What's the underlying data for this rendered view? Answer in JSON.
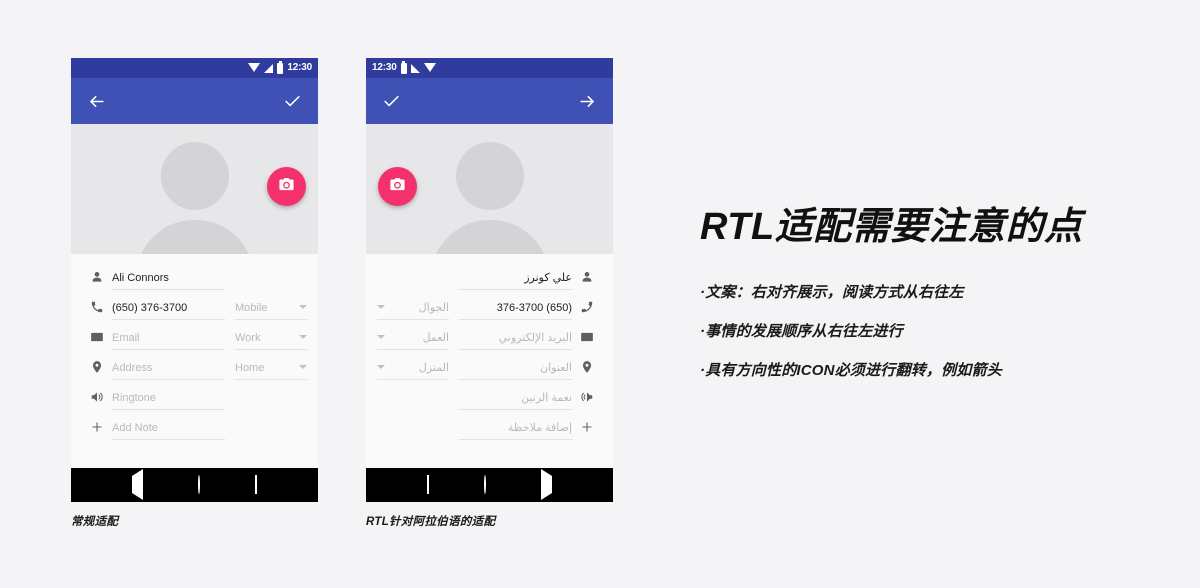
{
  "page": {
    "background": "#f4f4f6",
    "accent_appbar": "#3f51b5",
    "accent_statusbar": "#2f3c9e",
    "accent_fab": "#f5316d"
  },
  "phone_ltr": {
    "caption": "常规适配",
    "status_bar": {
      "time": "12:30",
      "icons": [
        "wifi-icon",
        "signal-icon",
        "battery-icon"
      ]
    },
    "app_bar": {
      "nav_icon": "arrow-back-icon",
      "action_icon": "check-icon"
    },
    "header": {
      "avatar": "person-placeholder-avatar",
      "fab_icon": "camera-icon"
    },
    "fields": [
      {
        "icon": "person-icon",
        "value": "Ali Connors",
        "is_placeholder": false,
        "type": ""
      },
      {
        "icon": "phone-icon",
        "value": "(650) 376-3700",
        "is_placeholder": false,
        "type": "Mobile"
      },
      {
        "icon": "email-icon",
        "value": "Email",
        "is_placeholder": true,
        "type": "Work"
      },
      {
        "icon": "location-icon",
        "value": "Address",
        "is_placeholder": true,
        "type": "Home"
      },
      {
        "icon": "ringtone-icon",
        "value": "Ringtone",
        "is_placeholder": true,
        "type": ""
      },
      {
        "icon": "plus-icon",
        "value": "Add Note",
        "is_placeholder": true,
        "type": ""
      }
    ],
    "nav_bar": [
      "back-triangle-icon",
      "home-circle-icon",
      "recents-square-icon"
    ]
  },
  "phone_rtl": {
    "caption": "RTL针对阿拉伯语的适配",
    "status_bar": {
      "time": "12:30",
      "icons": [
        "battery-icon",
        "signal-icon-mirrored",
        "wifi-icon"
      ]
    },
    "app_bar": {
      "nav_icon": "check-icon",
      "action_icon": "arrow-forward-icon"
    },
    "header": {
      "avatar": "person-placeholder-avatar",
      "fab_icon": "camera-icon"
    },
    "fields": [
      {
        "icon": "person-icon",
        "value": "علي كونرز",
        "is_placeholder": false,
        "type": ""
      },
      {
        "icon": "phone-icon",
        "value": "(650) 376-3700",
        "is_placeholder": false,
        "type": "الجوال"
      },
      {
        "icon": "email-icon",
        "value": "البريد الإلكتروني",
        "is_placeholder": true,
        "type": "العمل"
      },
      {
        "icon": "location-icon",
        "value": "العنوان",
        "is_placeholder": true,
        "type": "المنزل"
      },
      {
        "icon": "ringtone-icon",
        "value": "نغمة الرنين",
        "is_placeholder": true,
        "type": ""
      },
      {
        "icon": "plus-icon",
        "value": "إضافة ملاحظة",
        "is_placeholder": true,
        "type": ""
      }
    ],
    "nav_bar": [
      "recents-square-icon",
      "home-circle-icon",
      "back-triangle-icon-mirrored"
    ]
  },
  "panel": {
    "title": "RTL适配需要注意的点",
    "bullets": [
      "·文案：右对齐展示，阅读方式从右往左",
      "·事情的发展顺序从右往左进行",
      "·具有方向性的ICON必须进行翻转，例如箭头"
    ]
  }
}
